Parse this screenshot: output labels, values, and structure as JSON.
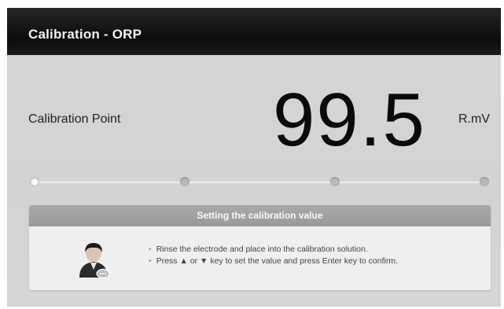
{
  "window": {
    "title": "Calibration - ORP"
  },
  "calibration": {
    "label": "Calibration Point",
    "value": "99.5",
    "unit": "R.mV"
  },
  "progress": {
    "total_steps": 4,
    "current_step": 1
  },
  "panel": {
    "header": "Setting the calibration value",
    "bullet": "•",
    "instructions": [
      "Rinse the electrode and place into the calibration solution.",
      "Press ▲ or ▼ key to set the value and press Enter key to confirm."
    ]
  },
  "icons": {
    "operator": "operator-avatar-icon"
  }
}
